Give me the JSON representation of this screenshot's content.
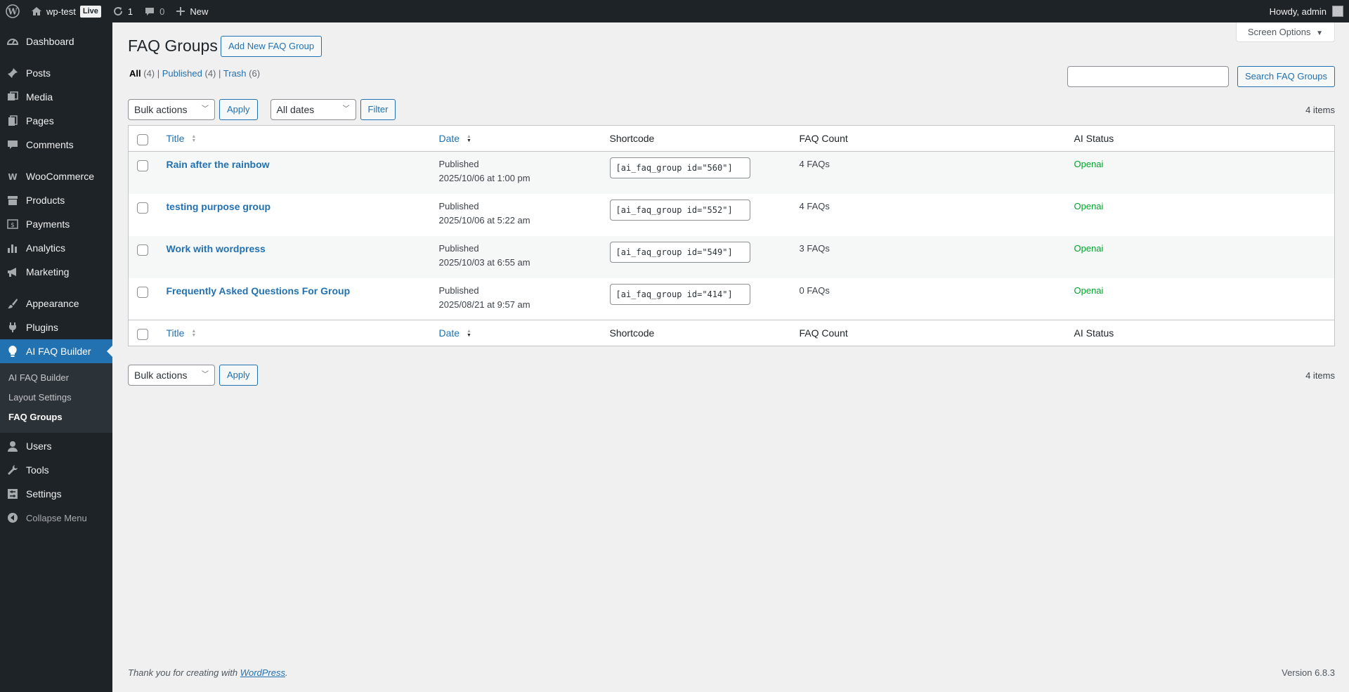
{
  "admin_bar": {
    "site_name": "wp-test",
    "live_badge": "Live",
    "updates_count": "1",
    "comments_count": "0",
    "new_label": "New",
    "howdy": "Howdy, admin"
  },
  "menu": {
    "dashboard": "Dashboard",
    "posts": "Posts",
    "media": "Media",
    "pages": "Pages",
    "comments": "Comments",
    "woocommerce": "WooCommerce",
    "products": "Products",
    "payments": "Payments",
    "analytics": "Analytics",
    "marketing": "Marketing",
    "appearance": "Appearance",
    "plugins": "Plugins",
    "ai_faq_builder": "AI FAQ Builder",
    "sub": [
      "AI FAQ Builder",
      "Layout Settings",
      "FAQ Groups"
    ],
    "users": "Users",
    "tools": "Tools",
    "settings": "Settings",
    "collapse": "Collapse Menu"
  },
  "page": {
    "screen_options": "Screen Options",
    "title": "FAQ Groups",
    "add_new": "Add New FAQ Group",
    "views": {
      "all": "All",
      "all_count": "(4)",
      "published": "Published",
      "published_count": "(4)",
      "trash": "Trash",
      "trash_count": "(6)"
    },
    "search_button": "Search FAQ Groups",
    "bulk_actions": "Bulk actions",
    "apply": "Apply",
    "all_dates": "All dates",
    "filter": "Filter",
    "items_count": "4 items"
  },
  "table": {
    "headers": {
      "title": "Title",
      "date": "Date",
      "shortcode": "Shortcode",
      "faq_count": "FAQ Count",
      "ai_status": "AI Status"
    },
    "rows": [
      {
        "title": "Rain after the rainbow",
        "status": "Published",
        "date": "2025/10/06 at 1:00 pm",
        "shortcode": "[ai_faq_group id=\"560\"]",
        "faq_count": "4 FAQs",
        "ai_status": "Openai"
      },
      {
        "title": "testing purpose group",
        "status": "Published",
        "date": "2025/10/06 at 5:22 am",
        "shortcode": "[ai_faq_group id=\"552\"]",
        "faq_count": "4 FAQs",
        "ai_status": "Openai"
      },
      {
        "title": "Work with wordpress",
        "status": "Published",
        "date": "2025/10/03 at 6:55 am",
        "shortcode": "[ai_faq_group id=\"549\"]",
        "faq_count": "3 FAQs",
        "ai_status": "Openai"
      },
      {
        "title": "Frequently Asked Questions For Group",
        "status": "Published",
        "date": "2025/08/21 at 9:57 am",
        "shortcode": "[ai_faq_group id=\"414\"]",
        "faq_count": "0 FAQs",
        "ai_status": "Openai"
      }
    ]
  },
  "footer": {
    "thanks_prefix": "Thank you for creating with ",
    "wordpress_link": "WordPress",
    "thanks_suffix": ".",
    "version": "Version 6.8.3"
  },
  "colors": {
    "admin_bg": "#1d2327",
    "accent": "#2271b1",
    "status_green": "#00a32a"
  }
}
